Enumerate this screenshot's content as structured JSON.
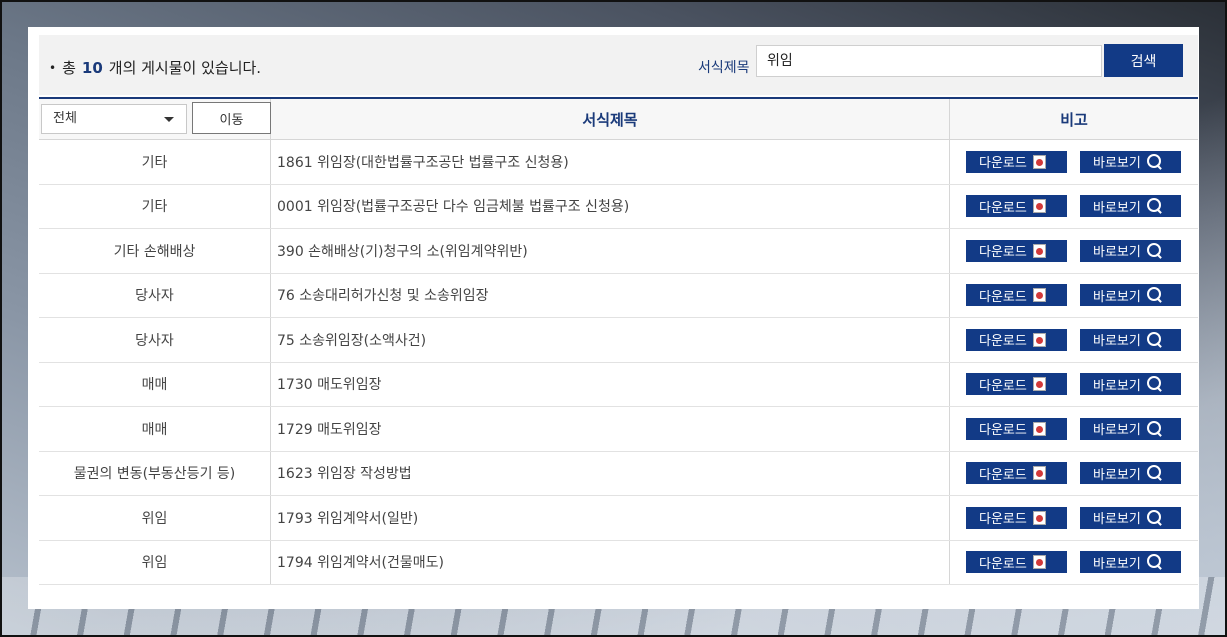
{
  "summary": {
    "prefix": "총",
    "count": "10",
    "suffix": "개의 게시물이 있습니다."
  },
  "search": {
    "label": "서식제목",
    "value": "위임",
    "button": "검색"
  },
  "filter": {
    "selected": "전체",
    "move_button": "이동"
  },
  "columns": {
    "title": "서식제목",
    "note": "비고"
  },
  "actions": {
    "download": "다운로드",
    "view": "바로보기"
  },
  "rows": [
    {
      "category": "기타",
      "title": "1861 위임장(대한법률구조공단 법률구조 신청용)"
    },
    {
      "category": "기타",
      "title": "0001 위임장(법률구조공단 다수 임금체불 법률구조 신청용)"
    },
    {
      "category": "기타 손해배상",
      "title": "390 손해배상(기)청구의 소(위임계약위반)"
    },
    {
      "category": "당사자",
      "title": "76 소송대리허가신청 및 소송위임장"
    },
    {
      "category": "당사자",
      "title": "75 소송위임장(소액사건)"
    },
    {
      "category": "매매",
      "title": "1730 매도위임장"
    },
    {
      "category": "매매",
      "title": "1729 매도위임장"
    },
    {
      "category": "물권의 변동(부동산등기 등)",
      "title": "1623 위임장 작성방법"
    },
    {
      "category": "위임",
      "title": "1793 위임계약서(일반)"
    },
    {
      "category": "위임",
      "title": "1794 위임계약서(건물매도)"
    }
  ]
}
